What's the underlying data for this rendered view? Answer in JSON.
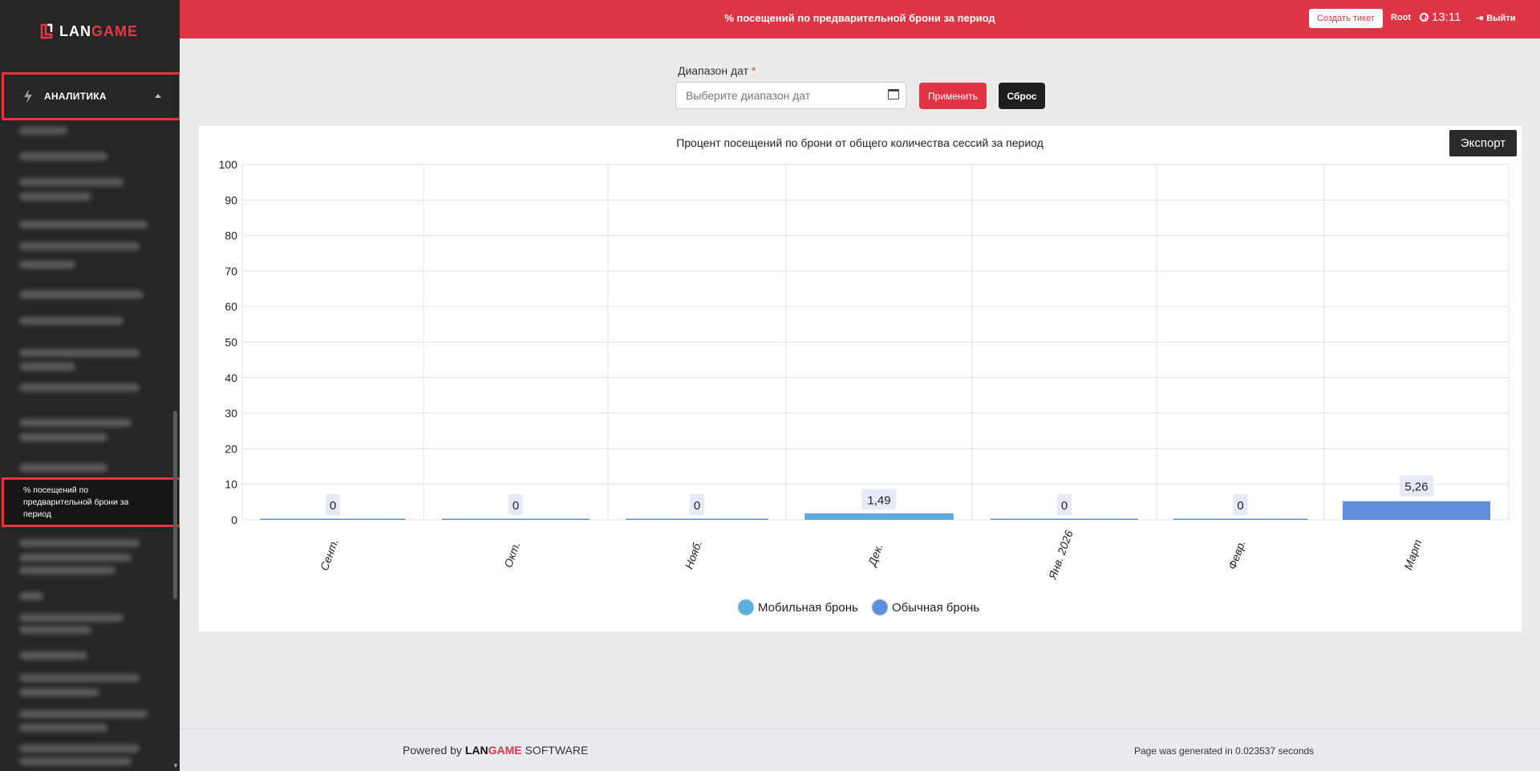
{
  "app": {
    "logo": {
      "part1": "LAN",
      "part2": "GAME"
    }
  },
  "sidebar": {
    "group_label": "АНАЛИТИКА",
    "active_item": "% посещений по предварительной брони за период"
  },
  "header": {
    "title": "% посещений по предварительной брони за период",
    "ticket_button": "Создать тикет",
    "user": "Root",
    "time": "13:11",
    "logout": "Выйти"
  },
  "filter": {
    "label": "Диапазон дат",
    "required_mark": "*",
    "placeholder": "Выберите диапазон дат",
    "apply": "Применить",
    "reset": "Сброс"
  },
  "export_button": "Экспорт",
  "chart_data": {
    "type": "bar",
    "title": "Процент посещений по брони от общего количества сессий за период",
    "categories": [
      "Сент.",
      "Окт.",
      "Нояб.",
      "Дек.",
      "Янв. 2026",
      "Февр.",
      "Март"
    ],
    "series": [
      {
        "name": "Мобильная бронь",
        "color": "#5aafdd",
        "values": [
          0,
          0,
          0,
          1.49,
          0,
          0,
          0
        ]
      },
      {
        "name": "Обычная бронь",
        "color": "#5f8fdc",
        "values": [
          0,
          0,
          0,
          0,
          0,
          0,
          5.26
        ]
      }
    ],
    "data_labels": [
      "0",
      "0",
      "0",
      "1,49",
      "0",
      "0",
      "5,26"
    ],
    "ylim": [
      0,
      100
    ],
    "yticks": [
      0,
      10,
      20,
      30,
      40,
      50,
      60,
      70,
      80,
      90,
      100
    ],
    "grid": true,
    "stacked": true,
    "legend_position": "bottom-center"
  },
  "footer": {
    "powered_prefix": "Powered by",
    "brand_part1": "LAN",
    "brand_part2": "GAME",
    "powered_suffix": "SOFTWARE",
    "generated": "Page was generated in 0.023537 seconds"
  }
}
